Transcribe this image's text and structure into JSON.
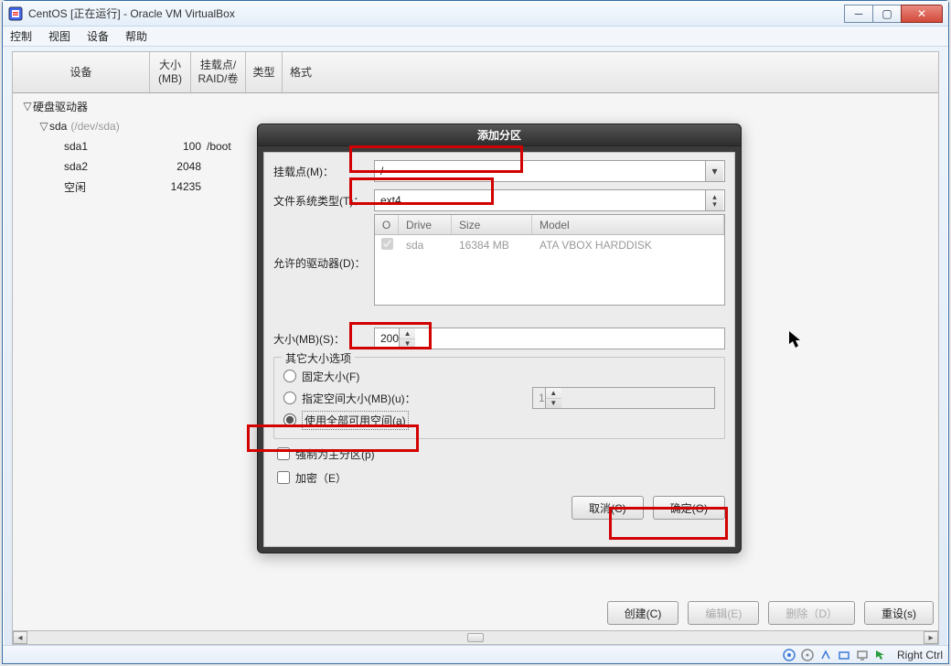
{
  "window": {
    "title": "CentOS [正在运行] - Oracle VM VirtualBox"
  },
  "menu": {
    "control": "控制",
    "view": "视图",
    "devices": "设备",
    "help": "帮助"
  },
  "columns": {
    "device": "设备",
    "size": "大小\n(MB)",
    "mount": "挂载点/\nRAID/卷",
    "type": "类型",
    "format": "格式"
  },
  "tree": {
    "root": "硬盘驱动器",
    "sda_label": "sda",
    "sda_dim": "(/dev/sda)",
    "rows": [
      {
        "name": "sda1",
        "size": "100",
        "mount": "/boot"
      },
      {
        "name": "sda2",
        "size": "2048",
        "mount": ""
      },
      {
        "name": "空闲",
        "size": "14235",
        "mount": ""
      }
    ]
  },
  "dialog": {
    "title": "添加分区",
    "mount_label": "挂载点(M)：",
    "mount_value": "/",
    "fstype_label": "文件系统类型(T)：",
    "fstype_value": "ext4",
    "allowed_label": "允许的驱动器(D)：",
    "drives_hdr": {
      "check": "O",
      "drive": "Drive",
      "size": "Size",
      "model": "Model"
    },
    "drives_row": {
      "drive": "sda",
      "size": "16384 MB",
      "model": "ATA VBOX HARDDISK"
    },
    "size_label": "大小(MB)(S)：",
    "size_value": "200",
    "group_legend": "其它大小选项",
    "opt_fixed": "固定大小(F)",
    "opt_fill_to": "指定空间大小(MB)(u)：",
    "opt_fill_to_value": "1",
    "opt_fill_all": "使用全部可用空间(a)",
    "force_primary": "强制为主分区(p)",
    "encrypt": "加密（E）",
    "cancel": "取消(C)",
    "ok": "确定(O)"
  },
  "buttons": {
    "create": "创建(C)",
    "edit": "编辑(E)",
    "delete": "删除（D）",
    "reset": "重设(s)"
  },
  "status": {
    "hostkey": "Right Ctrl"
  }
}
